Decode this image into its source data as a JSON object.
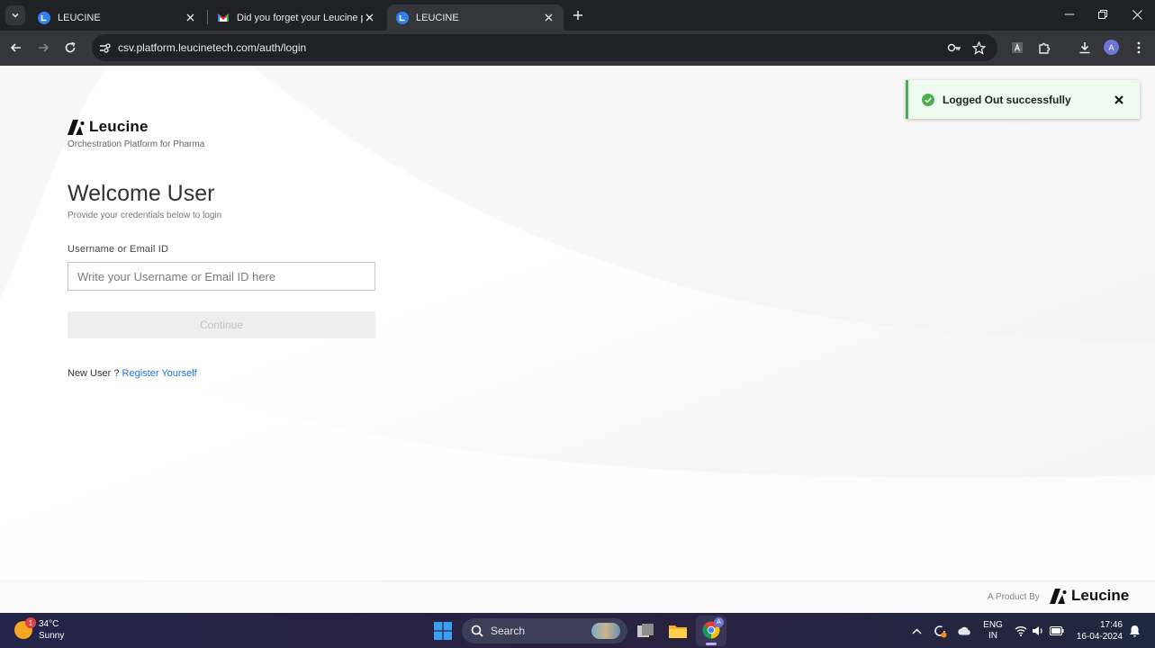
{
  "browser": {
    "tabs": [
      {
        "title": "LEUCINE",
        "favicon": "leucine-favicon",
        "active": false
      },
      {
        "title": "Did you forget your Leucine pa",
        "favicon": "gmail-favicon",
        "active": false
      },
      {
        "title": "LEUCINE",
        "favicon": "leucine-favicon",
        "active": true
      }
    ],
    "url": "csv.platform.leucinetech.com/auth/login",
    "profile_initial": "A"
  },
  "page": {
    "brand_name": "Leucine",
    "tagline": "Orchestration Platform for Pharma",
    "welcome_title": "Welcome User",
    "welcome_subtitle": "Provide your credentials below to login",
    "username_label": "Username or Email ID",
    "username_value": "",
    "username_placeholder": "Write your Username or Email ID here",
    "continue_label": "Continue",
    "new_user_text": "New User ?",
    "register_link": "Register Yourself",
    "toast_message": "Logged Out successfully",
    "footer_product_by": "A Product By",
    "footer_brand": "Leucine"
  },
  "taskbar": {
    "weather_temp": "34°C",
    "weather_desc": "Sunny",
    "weather_badge": "1",
    "search_label": "Search",
    "lang_line1": "ENG",
    "lang_line2": "IN",
    "time": "17:46",
    "date": "16-04-2024",
    "chrome_badge": "A"
  },
  "colors": {
    "toast_accent": "#4caf50",
    "link": "#1f73d8",
    "chrome_dark": "#202124",
    "chrome_toolbar": "#35363a"
  }
}
